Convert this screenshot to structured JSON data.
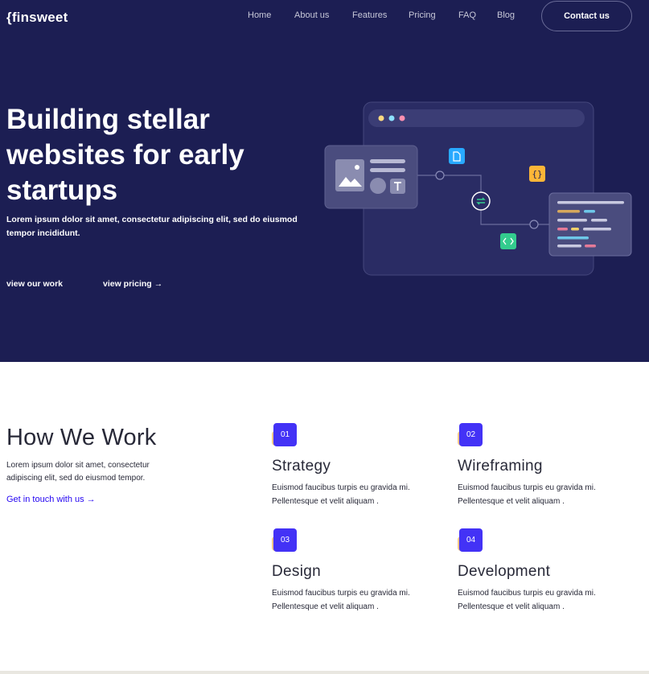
{
  "brand": {
    "logo": "{finsweet"
  },
  "nav": {
    "links": [
      "Home",
      "About us",
      "Features",
      "Pricing",
      "FAQ",
      "Blog"
    ],
    "contact_label": "Contact us"
  },
  "hero": {
    "title": "Building stellar websites for early startups",
    "subtitle": "Lorem ipsum dolor sit amet, consectetur adipiscing elit, sed do eiusmod tempor incididunt.",
    "link_work": "view our work",
    "link_pricing": "view pricing",
    "colors": {
      "background": "#1c1e53",
      "window": "#2a2c64",
      "accent_blue": "#28a9ff",
      "accent_yellow": "#fcb638",
      "accent_green": "#33cc8e"
    }
  },
  "how": {
    "title": "How We Work",
    "subtitle": "Lorem ipsum dolor sit amet, consectetur adipiscing elit, sed do eiusmod tempor.",
    "cta": "Get in touch with us",
    "steps": [
      {
        "num": "01",
        "title": "Strategy",
        "text": "Euismod faucibus turpis eu gravida mi. Pellentesque et velit aliquam ."
      },
      {
        "num": "02",
        "title": "Wireframing",
        "text": "Euismod faucibus turpis eu gravida mi. Pellentesque et velit aliquam ."
      },
      {
        "num": "03",
        "title": "Design",
        "text": "Euismod faucibus turpis eu gravida mi. Pellentesque et velit aliquam ."
      },
      {
        "num": "04",
        "title": "Development",
        "text": "Euismod faucibus turpis eu gravida mi. Pellentesque et velit aliquam ."
      }
    ],
    "colors": {
      "badge": "#4332f6",
      "badge_shadow": "#f3c888",
      "link": "#2405f2"
    }
  }
}
